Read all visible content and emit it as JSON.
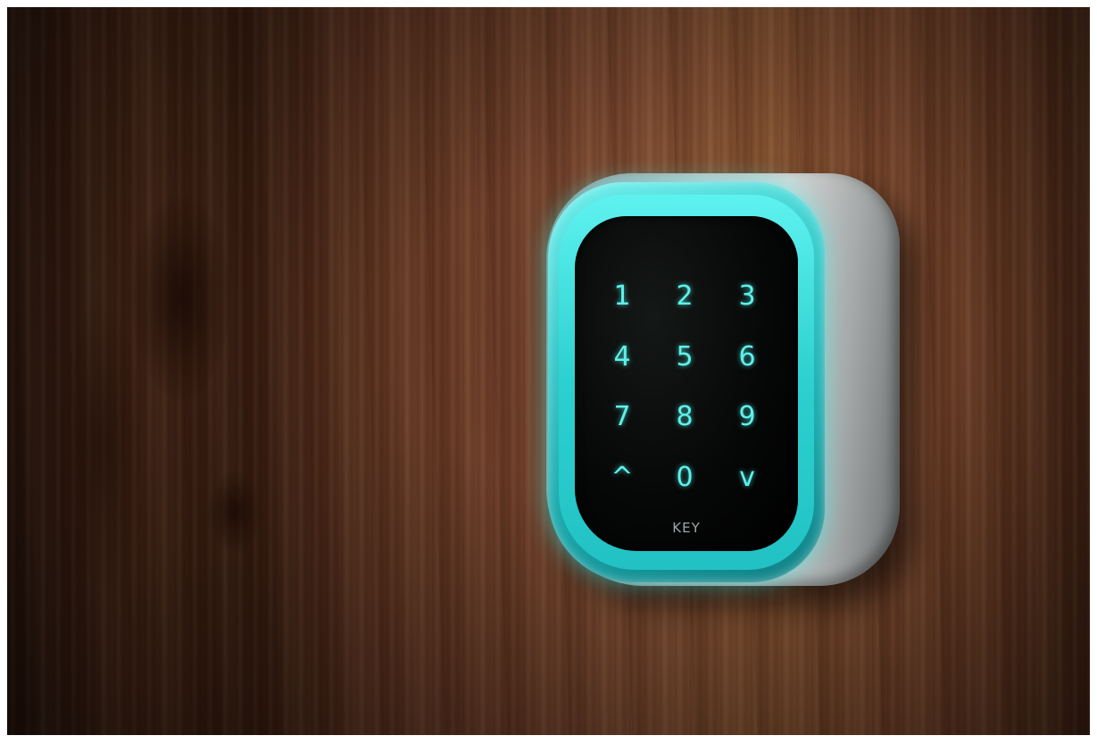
{
  "scene": {
    "description_tags": [
      "wood-panel",
      "keypad-lock"
    ],
    "colors": {
      "wood": "#6b3c27",
      "glow": "#3fd8d6",
      "digit": "#5ff0ea",
      "housing": "#c9cbcb"
    }
  },
  "keypad": {
    "keys": [
      "1",
      "2",
      "3",
      "4",
      "5",
      "6",
      "7",
      "8",
      "9",
      "^",
      "0",
      "v"
    ],
    "brand": "KEY"
  }
}
